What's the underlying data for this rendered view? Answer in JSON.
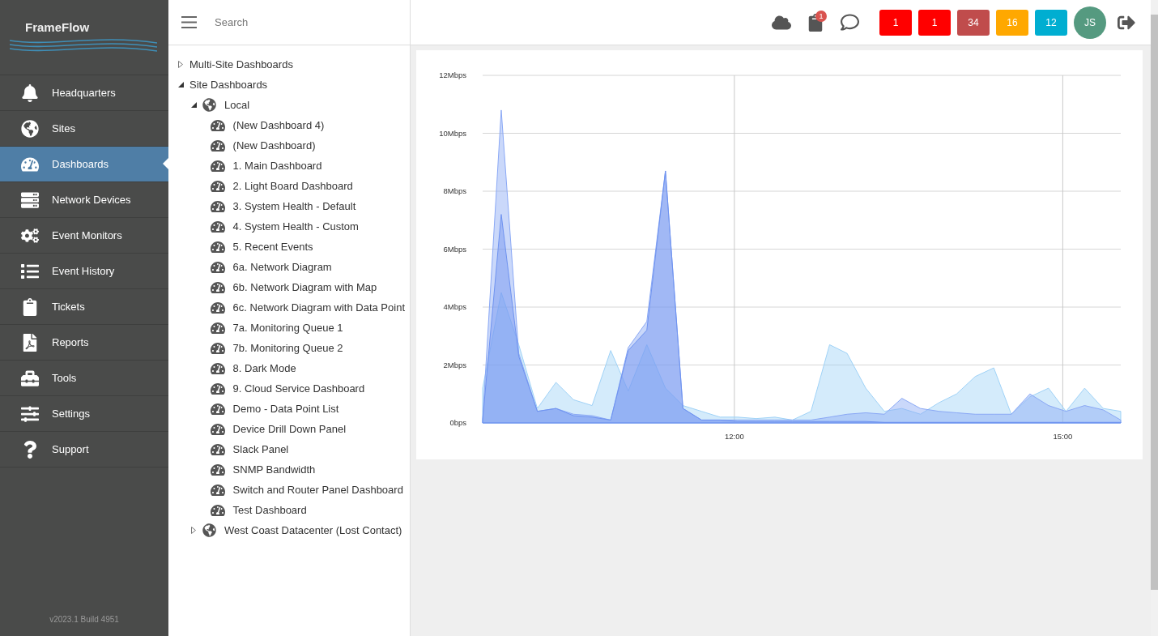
{
  "sidebar": {
    "logo": "FrameFlow",
    "items": [
      {
        "label": "Headquarters",
        "kind": "bell",
        "selected": false
      },
      {
        "label": "Sites",
        "kind": "globe",
        "selected": false
      },
      {
        "label": "Dashboards",
        "kind": "gauge",
        "selected": true
      },
      {
        "label": "Network Devices",
        "kind": "server",
        "selected": false
      },
      {
        "label": "Event Monitors",
        "kind": "cogs",
        "selected": false
      },
      {
        "label": "Event History",
        "kind": "list",
        "selected": false
      },
      {
        "label": "Tickets",
        "kind": "clipboard",
        "selected": false
      },
      {
        "label": "Reports",
        "kind": "report",
        "selected": false
      },
      {
        "label": "Tools",
        "kind": "toolbox",
        "selected": false
      },
      {
        "label": "Settings",
        "kind": "sliders",
        "selected": false
      },
      {
        "label": "Support",
        "kind": "question",
        "selected": false
      }
    ],
    "version": "v2023.1 Build 4951"
  },
  "tree": {
    "search": {
      "placeholder": "Search"
    },
    "items": [
      {
        "label": "Multi-Site Dashboards",
        "kind": "group",
        "expanded": false
      },
      {
        "label": "Site Dashboards",
        "kind": "group",
        "expanded": true,
        "children": [
          {
            "label": "Local",
            "kind": "site",
            "expanded": true,
            "children": [
              {
                "label": "(New Dashboard 4)",
                "kind": "dashboard"
              },
              {
                "label": "(New Dashboard)",
                "kind": "dashboard"
              },
              {
                "label": "1. Main Dashboard",
                "kind": "dashboard"
              },
              {
                "label": "2. Light Board Dashboard",
                "kind": "dashboard"
              },
              {
                "label": "3. System Health - Default",
                "kind": "dashboard"
              },
              {
                "label": "4. System Health - Custom",
                "kind": "dashboard"
              },
              {
                "label": "5. Recent Events",
                "kind": "dashboard"
              },
              {
                "label": "6a. Network Diagram",
                "kind": "dashboard"
              },
              {
                "label": "6b. Network Diagram with Map",
                "kind": "dashboard"
              },
              {
                "label": "6c. Network Diagram with Data Point",
                "kind": "dashboard"
              },
              {
                "label": "7a. Monitoring Queue 1",
                "kind": "dashboard"
              },
              {
                "label": "7b. Monitoring Queue 2",
                "kind": "dashboard"
              },
              {
                "label": "8. Dark Mode",
                "kind": "dashboard"
              },
              {
                "label": "9. Cloud Service Dashboard",
                "kind": "dashboard"
              },
              {
                "label": "Demo - Data Point List",
                "kind": "dashboard"
              },
              {
                "label": "Device Drill Down Panel",
                "kind": "dashboard"
              },
              {
                "label": "Slack Panel",
                "kind": "dashboard"
              },
              {
                "label": "SNMP Bandwidth",
                "kind": "dashboard"
              },
              {
                "label": "Switch and Router Panel Dashboard",
                "kind": "dashboard"
              },
              {
                "label": "Test Dashboard",
                "kind": "dashboard"
              }
            ]
          },
          {
            "label": "West Coast Datacenter (Lost Contact)",
            "kind": "site",
            "expanded": false
          }
        ]
      }
    ]
  },
  "topbar": {
    "tickets_badge": "1",
    "status_counts": [
      {
        "count": "1",
        "color": "#ff0000"
      },
      {
        "count": "1",
        "color": "#ff0000"
      },
      {
        "count": "34",
        "color": "#c04c4c"
      },
      {
        "count": "16",
        "color": "#ffa800"
      },
      {
        "count": "12",
        "color": "#00aed1"
      }
    ],
    "avatar": "JS"
  },
  "chart_data": {
    "type": "area",
    "grid": true,
    "x": [
      9.7,
      9.87,
      10.03,
      10.2,
      10.37,
      10.53,
      10.7,
      10.87,
      11.03,
      11.2,
      11.37,
      11.53,
      11.7,
      11.87,
      12.03,
      12.2,
      12.37,
      12.53,
      12.7,
      12.87,
      13.03,
      13.2,
      13.37,
      13.53,
      13.7,
      13.87,
      14.03,
      14.2,
      14.37,
      14.53,
      14.7,
      14.87,
      15.03,
      15.2,
      15.37,
      15.53
    ],
    "xlim": [
      9.7,
      15.53
    ],
    "ylim": [
      0,
      12
    ],
    "xticks": [
      {
        "value": 12,
        "label": "12:00"
      },
      {
        "value": 15,
        "label": "15:00"
      }
    ],
    "yticks": [
      {
        "value": 0,
        "label": "0bps"
      },
      {
        "value": 2,
        "label": "2Mbps"
      },
      {
        "value": 4,
        "label": "4Mbps"
      },
      {
        "value": 6,
        "label": "6Mbps"
      },
      {
        "value": 8,
        "label": "8Mbps"
      },
      {
        "value": 10,
        "label": "10Mbps"
      },
      {
        "value": 12,
        "label": "12Mbps"
      }
    ],
    "series": [
      {
        "color": "#9fd2f7",
        "values": [
          1.2,
          4.5,
          2.7,
          0.5,
          1.4,
          0.8,
          0.6,
          2.5,
          1.1,
          2.7,
          1.2,
          0.6,
          0.4,
          0.2,
          0.2,
          0.15,
          0.2,
          0.1,
          0.4,
          2.7,
          2.4,
          1.2,
          0.4,
          0.5,
          0.3,
          0.7,
          1.0,
          1.6,
          1.9,
          0.3,
          0.9,
          1.2,
          0.4,
          1.2,
          0.5,
          0.4
        ]
      },
      {
        "color": "#8aa8f5",
        "values": [
          0.1,
          10.8,
          2.4,
          0.4,
          0.5,
          0.3,
          0.25,
          0.1,
          2.6,
          3.5,
          8.7,
          0.5,
          0.1,
          0.1,
          0.1,
          0.1,
          0.1,
          0.1,
          0.1,
          0.2,
          0.3,
          0.35,
          0.3,
          0.85,
          0.5,
          0.4,
          0.35,
          0.3,
          0.3,
          0.3,
          1.0,
          0.6,
          0.4,
          0.6,
          0.45,
          0.1
        ]
      },
      {
        "color": "#6f93f0",
        "values": [
          0.1,
          7.2,
          2.3,
          0.4,
          0.5,
          0.25,
          0.2,
          0.1,
          2.5,
          3.2,
          8.7,
          0.5,
          0.1,
          0.1,
          0.05,
          0.05,
          0.05,
          0.05,
          0.05,
          0.05,
          0.05,
          0.05,
          0.02,
          0.02,
          0.02,
          0.02,
          0.02,
          0.02,
          0.02,
          0.02,
          0.02,
          0.02,
          0.02,
          0.02,
          0.02,
          0.02
        ]
      }
    ]
  }
}
